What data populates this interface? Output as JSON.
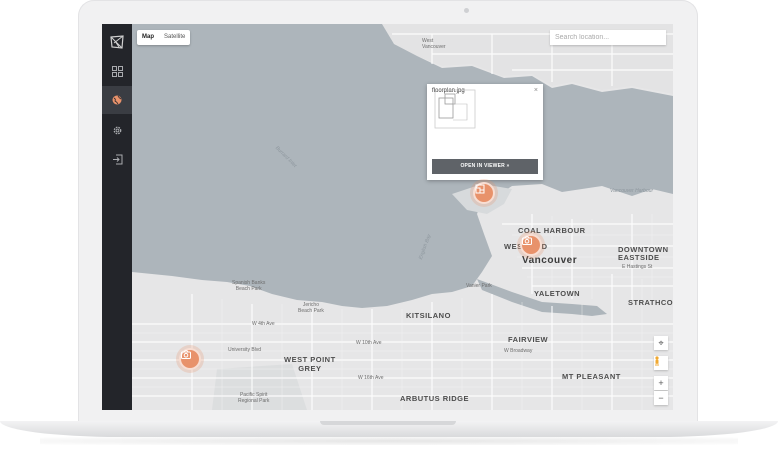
{
  "nav": {
    "items": [
      {
        "name": "dashboard",
        "icon": "grid-icon"
      },
      {
        "name": "map",
        "icon": "globe-icon",
        "active": true
      },
      {
        "name": "settings",
        "icon": "gear-icon"
      },
      {
        "name": "logout",
        "icon": "logout-icon"
      }
    ]
  },
  "map_type": {
    "map_label": "Map",
    "satellite_label": "Satellite",
    "selected": "Map"
  },
  "search": {
    "placeholder": "Search location..."
  },
  "popup": {
    "title": "floorplan.jpg",
    "close": "×",
    "button_label": "OPEN IN VIEWER »"
  },
  "labels": {
    "west_vancouver": "West\nVancouver",
    "burrard_inlet": "Burrard Inlet",
    "english_bay": "English Bay",
    "vancouver_harbour": "Vancouver Harbour",
    "coal_harbour": "COAL HARBOUR",
    "west_end": "WEST END",
    "vancouver": "Vancouver",
    "downtown_eastside": "DOWNTOWN\nEASTSIDE",
    "e_hastings": "E Hastings St",
    "yaletown": "YALETOWN",
    "strathcona": "STRATHCONA",
    "fairview": "FAIRVIEW",
    "kitsilano": "KITSILANO",
    "spanish_banks": "Spanish Banks\nBeach Park",
    "jericho": "Jericho\nBeach Park",
    "vanier": "Vanier Park",
    "west_point_grey": "WEST POINT\nGREY",
    "mt_pleasant": "MT PLEASANT",
    "arbutus_ridge": "ARBUTUS RIDGE",
    "pacific_spirit": "Pacific Spirit\nRegional Park",
    "w4": "W 4th Ave",
    "w10": "W 10th Ave",
    "w16": "W 16th Ave",
    "broadway": "W Broadway",
    "univ": "University Blvd"
  },
  "controls": {
    "locate": "⌖",
    "zoom_in": "+",
    "zoom_out": "−"
  },
  "colors": {
    "water": "#adb5bb",
    "land": "#e6e6e7",
    "pin": "#e8926b",
    "sidebar": "#23252a"
  }
}
